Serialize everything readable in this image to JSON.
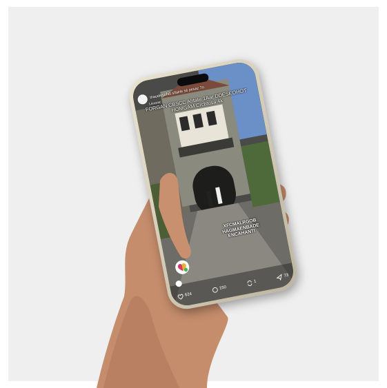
{
  "post": {
    "username": "thaudiosofalt.sifairle sé pesaz 7o",
    "sub_label": "Lieueac",
    "caption_top": "FORGAN CBSCC Ahtate 1Aar DDESEOHOT HOMGAM Crcbtusa 4k",
    "caption_mid": "XFCMALRGOB HAGMAENBADE ENCAHANTI"
  },
  "actions": {
    "likes": "624",
    "comments": "150",
    "reposts": "1",
    "shares": "73"
  },
  "colors": {
    "sky": "#6b8fc7",
    "stone": "#8a8a7e",
    "phone_frame": "#d9d2be"
  }
}
